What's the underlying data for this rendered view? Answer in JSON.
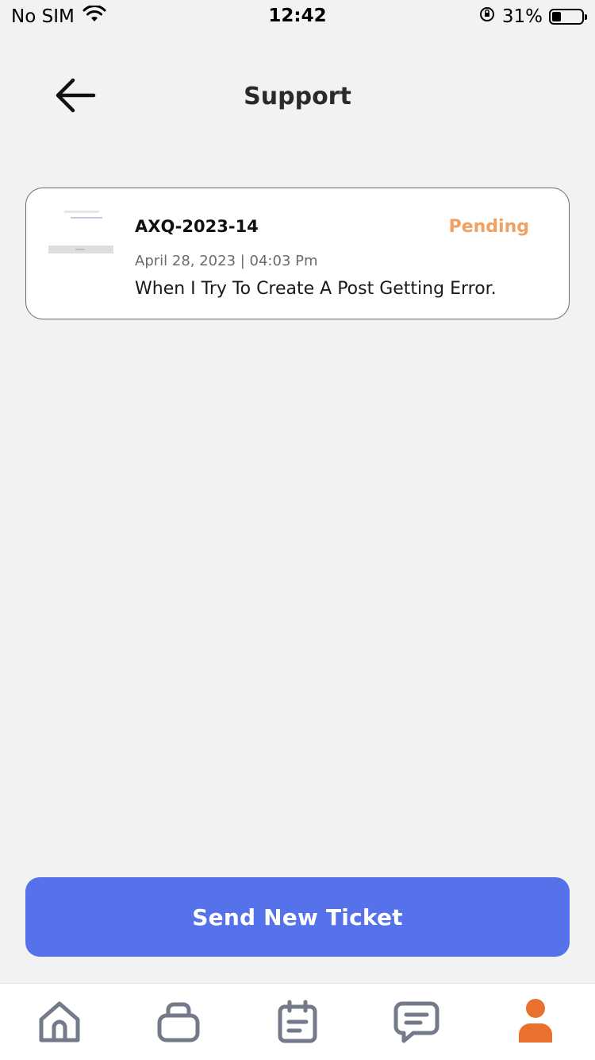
{
  "status_bar": {
    "carrier": "No SIM",
    "time": "12:42",
    "battery_text": "31%",
    "battery_level": 0.31
  },
  "header": {
    "title": "Support",
    "back_icon": "arrow-left-icon"
  },
  "tickets": [
    {
      "id": "AXQ-2023-14",
      "status": "Pending",
      "status_color": "#f0a060",
      "date": "April 28, 2023 | 04:03 Pm",
      "message": "When I Try To Create A Post Getting Error."
    }
  ],
  "send_button": {
    "label": "Send New Ticket",
    "color": "#5672ea"
  },
  "tab_bar": {
    "items": [
      {
        "icon": "home-icon",
        "active": false
      },
      {
        "icon": "briefcase-icon",
        "active": false
      },
      {
        "icon": "calendar-list-icon",
        "active": false
      },
      {
        "icon": "chat-icon",
        "active": false
      },
      {
        "icon": "profile-icon",
        "active": true
      }
    ],
    "active_color": "#e8712d",
    "inactive_color": "#747a8a"
  }
}
